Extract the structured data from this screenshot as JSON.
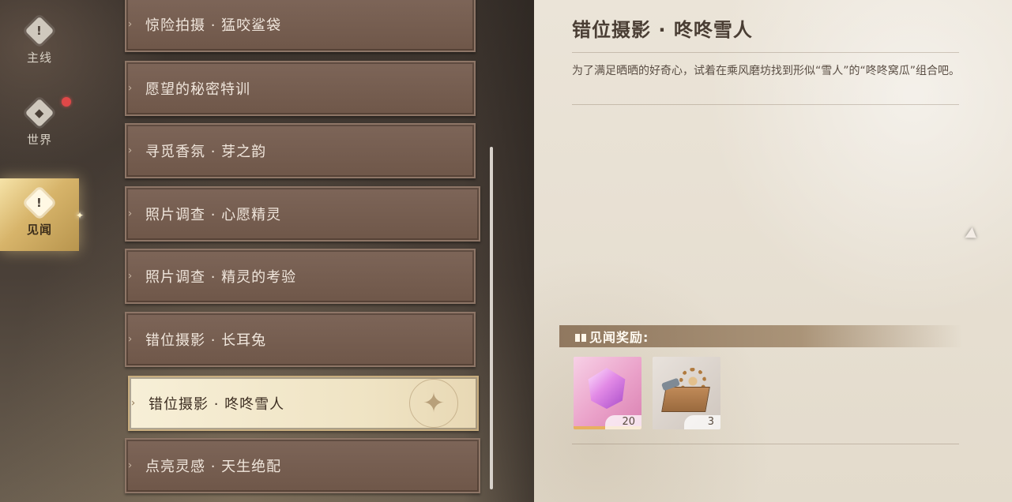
{
  "nav": {
    "items": [
      {
        "label": "主线",
        "icon": "exclamation-diamond-icon"
      },
      {
        "label": "世界",
        "icon": "diamond-icon"
      },
      {
        "label": "见闻",
        "icon": "exclamation-diamond-icon",
        "active": true
      }
    ],
    "badge": "red-dot"
  },
  "quests": [
    "惊险拍摄 · 猛咬鲨袋",
    "愿望的秘密特训",
    "寻觅香氛 · 芽之韵",
    "照片调查 · 心愿精灵",
    "照片调查 · 精灵的考验",
    "错位摄影 · 长耳兔",
    "错位摄影 · 咚咚雪人",
    "点亮灵感 · 天生绝配"
  ],
  "selected_quest_index": 6,
  "detail": {
    "title": "错位摄影 · 咚咚雪人",
    "description": "为了满足晒晒的好奇心，试着在乘风磨坊找到形似“雪人”的“咚咚窝瓜”组合吧。",
    "rewards_label": "见闻奖励:",
    "rewards": [
      {
        "icon": "pink-crystal-icon",
        "count": "20"
      },
      {
        "icon": "toolbox-gear-icon",
        "count": "3"
      }
    ]
  },
  "colors": {
    "accent_gold": "#d7b46a",
    "quest_card": "#7d6558",
    "panel_paper": "#ebe4d8",
    "notification_red": "#e04848"
  }
}
